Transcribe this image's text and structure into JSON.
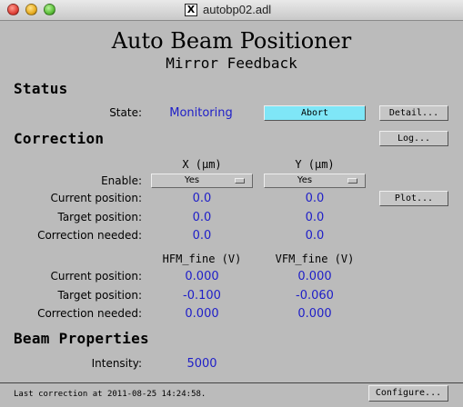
{
  "window": {
    "title": "autobp02.adl"
  },
  "header": {
    "title": "Auto Beam Positioner",
    "subtitle": "Mirror Feedback"
  },
  "status": {
    "heading": "Status",
    "state_label": "State:",
    "state_value": "Monitoring",
    "abort_label": "Abort",
    "detail_label": "Detail..."
  },
  "correction": {
    "heading": "Correction",
    "log_label": "Log...",
    "col_x": "X (µm)",
    "col_y": "Y (µm)",
    "enable_label": "Enable:",
    "enable_x": "Yes",
    "enable_y": "Yes",
    "plot_label": "Plot...",
    "rows": [
      {
        "label": "Current position:",
        "x": "0.0",
        "y": "0.0"
      },
      {
        "label": "Target position:",
        "x": "0.0",
        "y": "0.0"
      },
      {
        "label": "Correction needed:",
        "x": "0.0",
        "y": "0.0"
      }
    ],
    "col_hfm": "HFM_fine (V)",
    "col_vfm": "VFM_fine (V)",
    "fine_rows": [
      {
        "label": "Current position:",
        "hfm": "0.000",
        "vfm": "0.000"
      },
      {
        "label": "Target position:",
        "hfm": "-0.100",
        "vfm": "-0.060"
      },
      {
        "label": "Correction needed:",
        "hfm": "0.000",
        "vfm": "0.000"
      }
    ]
  },
  "beam": {
    "heading": "Beam Properties",
    "intensity_label": "Intensity:",
    "intensity_value": "5000"
  },
  "statusbar": {
    "text": "Last correction at 2011-08-25 14:24:58.",
    "configure_label": "Configure..."
  },
  "colors": {
    "value_text": "#1e1ec8",
    "abort_bg": "#7fe6f7",
    "background": "#bbbbbb"
  },
  "icons": [
    "close-icon",
    "minimize-icon",
    "zoom-icon",
    "x11-icon",
    "menu-arrow-icon"
  ]
}
